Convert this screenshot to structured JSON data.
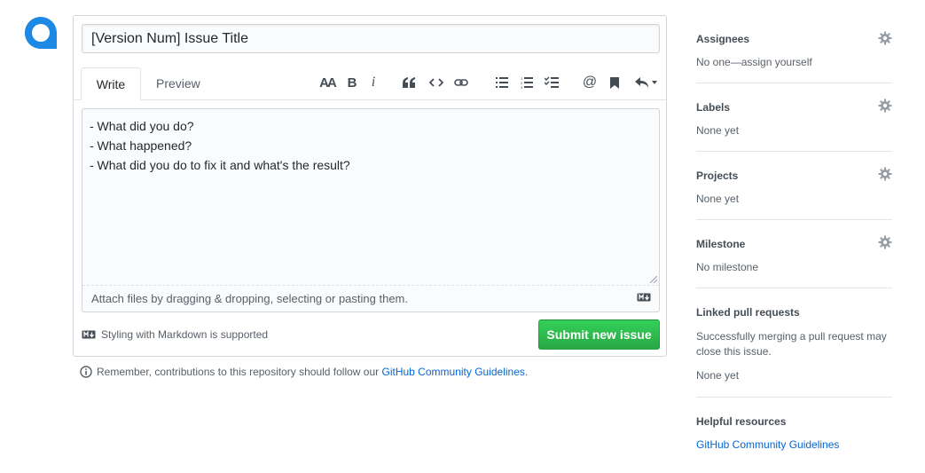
{
  "issue_form": {
    "title_value": "[Version Num] Issue Title",
    "tabs": {
      "write": "Write",
      "preview": "Preview"
    },
    "toolbar_icons": [
      "text-size-icon",
      "bold-icon",
      "italic-icon",
      "quote-icon",
      "code-icon",
      "link-icon",
      "bullet-list-icon",
      "numbered-list-icon",
      "task-list-icon",
      "mention-icon",
      "reference-icon",
      "reply-icon"
    ],
    "body_value": "- What did you do?\n- What happened?\n- What did you do to fix it and what's the result?",
    "attach_text": "Attach files by dragging & dropping, selecting or pasting them.",
    "markdown_note": "Styling with Markdown is supported",
    "submit_label": "Submit new issue"
  },
  "reminder": {
    "prefix": "Remember, contributions to this repository should follow our ",
    "link": "GitHub Community Guidelines",
    "suffix": "."
  },
  "sidebar": {
    "assignees": {
      "heading": "Assignees",
      "value": "No one—assign yourself"
    },
    "labels": {
      "heading": "Labels",
      "value": "None yet"
    },
    "projects": {
      "heading": "Projects",
      "value": "None yet"
    },
    "milestone": {
      "heading": "Milestone",
      "value": "No milestone"
    },
    "linked_prs": {
      "heading": "Linked pull requests",
      "description": "Successfully merging a pull request may close this issue.",
      "value": "None yet"
    },
    "helpful": {
      "heading": "Helpful resources",
      "link": "GitHub Community Guidelines"
    }
  },
  "colors": {
    "accent": "#0366d6",
    "submit": "#28a745",
    "avatar": "#1e88e5"
  }
}
